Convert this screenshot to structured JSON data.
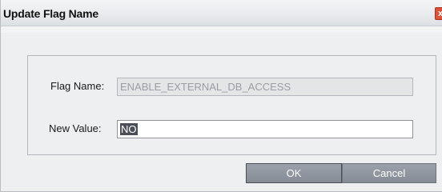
{
  "window": {
    "title": "Update Flag Name",
    "close_label": "x"
  },
  "form": {
    "flag_name_label": "Flag Name:",
    "flag_name_value": "ENABLE_EXTERNAL_DB_ACCESS",
    "new_value_label": "New Value:",
    "new_value_value": "NO"
  },
  "buttons": {
    "ok_label": "OK",
    "cancel_label": "Cancel"
  },
  "colors": {
    "button_bg": "#8f96a0",
    "close_bg": "#d9533a"
  }
}
